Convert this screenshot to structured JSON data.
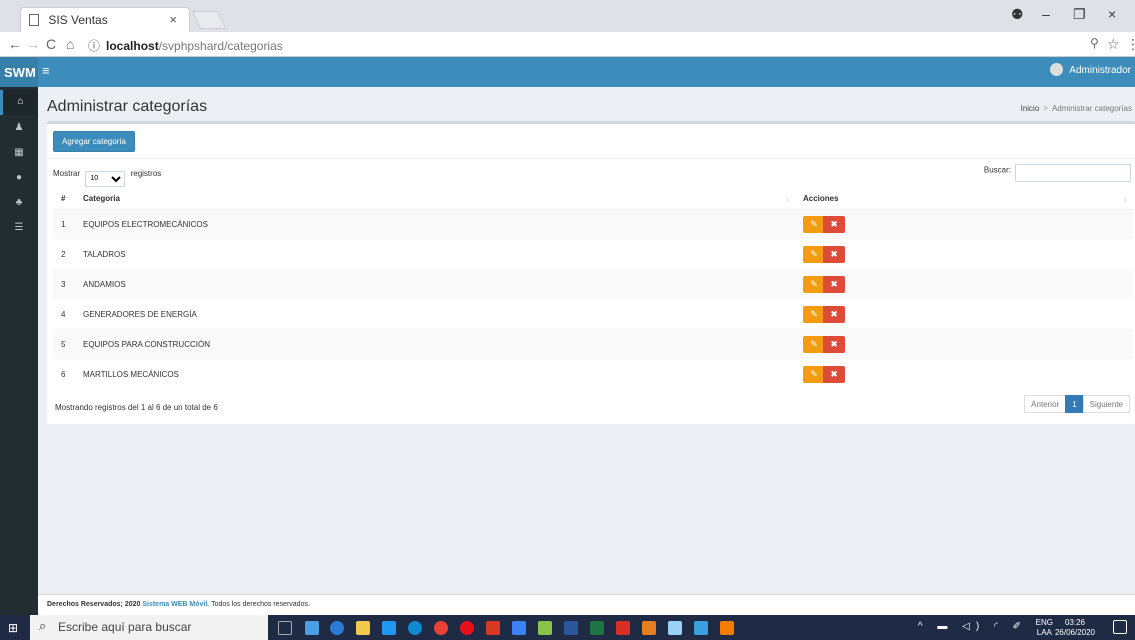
{
  "browser": {
    "tab_title": "SIS Ventas",
    "tab_close": "×",
    "url_scheme": "ⓘ",
    "url_host": "localhost",
    "url_path": "/svphpshard/categorias",
    "window_min": "–",
    "window_max": "❐",
    "window_close": "×",
    "back": "←",
    "forward": "→",
    "reload": "C",
    "home": "⌂",
    "zoom": "⚲",
    "star": "☆",
    "menu": "⋮",
    "account": "⚉"
  },
  "header": {
    "logo": "SWM",
    "toggle": "≡",
    "user": "Administrador"
  },
  "sidebar": {
    "items": [
      {
        "icon": "home-icon",
        "glyph": "⌂"
      },
      {
        "icon": "user-icon",
        "glyph": "♟"
      },
      {
        "icon": "grid-icon",
        "glyph": "▦"
      },
      {
        "icon": "circle-icon",
        "glyph": "●"
      },
      {
        "icon": "users-icon",
        "glyph": "♣"
      },
      {
        "icon": "list-icon",
        "glyph": "☰"
      }
    ]
  },
  "page": {
    "title": "Administrar categorías",
    "breadcrumb_home": "Inicio",
    "breadcrumb_sep": ">",
    "breadcrumb_current": "Administrar categorías"
  },
  "table_ctrl": {
    "add_button": "Agregar categoría",
    "show_label": "Mostrar",
    "show_value": "10",
    "records_label": "registros",
    "search_label": "Buscar:"
  },
  "table": {
    "headers": {
      "num": "#",
      "category": "Categoria",
      "actions": "Acciones"
    },
    "sort_icon": "↕",
    "edit_glyph": "✎",
    "delete_glyph": "✖",
    "rows": [
      {
        "num": "1",
        "name": "EQUIPOS ELECTROMECÁNICOS"
      },
      {
        "num": "2",
        "name": "TALADROS"
      },
      {
        "num": "3",
        "name": "ANDAMIOS"
      },
      {
        "num": "4",
        "name": "GENERADORES DE ENERGÍA"
      },
      {
        "num": "5",
        "name": "EQUIPOS PARA CONSTRUCCIÓN"
      },
      {
        "num": "6",
        "name": "MARTILLOS MECÁNICOS"
      }
    ]
  },
  "pagination": {
    "info": "Mostrando registros del 1 al 6 de un total de 6",
    "prev": "Anterior",
    "page": "1",
    "next": "Siguiente"
  },
  "footer": {
    "rights": "Derechos Reservados; 2020",
    "brand": "Sistema WEB Móvil.",
    "tail": "Todos los derechos reservados."
  },
  "taskbar": {
    "search_placeholder": "Escribe aquí para buscar",
    "lang_top": "ENG",
    "lang_bottom": "LAA",
    "time": "03:26",
    "date": "26/06/2020",
    "tray_symbols": "^ ▬ ◁) ◜ ✐"
  }
}
